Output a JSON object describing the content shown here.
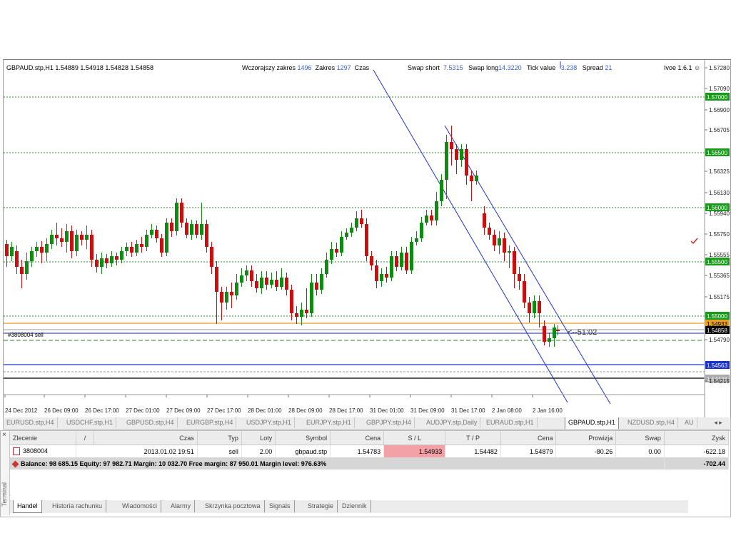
{
  "header": {
    "symbol_line": "GBPAUD.stp,H1  1.54889 1.54918 1.54828 1.54858",
    "wczoraj_label": "Wczorajszy zakres",
    "wczoraj_value": "1496",
    "zakres_label": "Zakres",
    "zakres_value": "1297",
    "czas_label": "Czas",
    "swap_short_label": "Swap short",
    "swap_short_value": "7.5315",
    "swap_long_label": "Swap long",
    "swap_long_value": "14.3220",
    "tick_value_label": "Tick value",
    "tick_value_value": "3.238",
    "spread_label": "Spread",
    "spread_value": "21",
    "indicator": "Ivoe 1.6.1"
  },
  "chart": {
    "order_label": "#3808004 sell",
    "timer": "<--51:02",
    "price_ticks": [
      "1.57280",
      "1.57090",
      "1.56900",
      "1.56705",
      "1.56325",
      "1.56130",
      "1.55940",
      "1.55750",
      "1.55555",
      "1.55365",
      "1.55175",
      "1.54790",
      "1.54215"
    ],
    "level_labels": [
      "1.57000",
      "1.56500",
      "1.56000",
      "1.55500",
      "1.55000"
    ],
    "orange_label": "1.54933",
    "current_label": "1.54858",
    "blue_label": "1.54563",
    "lower_label": "1.54436",
    "time_ticks": [
      "24 Dec 2012",
      "26 Dec 09:00",
      "26 Dec 17:00",
      "27 Dec 01:00",
      "27 Dec 09:00",
      "27 Dec 17:00",
      "28 Dec 01:00",
      "28 Dec 09:00",
      "28 Dec 17:00",
      "31 Dec 01:00",
      "31 Dec 09:00",
      "31 Dec 17:00",
      "2 Jan 08:00",
      "2 Jan 16:00"
    ],
    "colors": {
      "bull": "#118a11",
      "bear": "#c81010",
      "level": "#2e8b2e",
      "channel": "#2233cc",
      "orange": "#e8a020"
    }
  },
  "symbol_tabs": [
    "EURUSD.stp,H4",
    "USDCHF.stp,H1",
    "GBPUSD.stp,H4",
    "EURGBP.stp,H4",
    "USDJPY.stp,H1",
    "EURJPY.stp,H1",
    "GBPJPY.stp,H4",
    "AUDJPY.stp,Daily",
    "EURAUD.stp,H1",
    "GBPAUD.stp,H1",
    "NZDUSD.stp,H4",
    "AU"
  ],
  "active_symbol_tab": "GBPAUD.stp,H1",
  "tab_arrows": "◂ ▸",
  "terminal": {
    "close": "×",
    "vertical_label": "Terminal",
    "columns": [
      "Zlecenie",
      "/",
      "Czas",
      "Typ",
      "Loty",
      "Symbol",
      "Cena",
      "S / L",
      "T / P",
      "Cena",
      "Prowizja",
      "Swap",
      "Zysk"
    ],
    "order": {
      "id": "3808004",
      "time": "2013.01.02 19:51",
      "type": "sell",
      "lots": "2.00",
      "symbol": "gbpaud.stp",
      "price": "1.54783",
      "sl": "1.54933",
      "tp": "1.54482",
      "cur_price": "1.54879",
      "commission": "-80.26",
      "swap": "0.00",
      "profit": "-622.18"
    },
    "balance_line": "Balance: 98 685.15  Equity: 97 982.71  Margin: 10 032.70  Free margin: 87 950.01  Margin level: 976.63%",
    "balance_total": "-702.44",
    "bottom_tabs": [
      "Handel",
      "Historia rachunku",
      "Wiadomości",
      "Alarmy",
      "Skrzynka pocztowa",
      "Signals",
      "Strategie",
      "Dziennik"
    ]
  }
}
